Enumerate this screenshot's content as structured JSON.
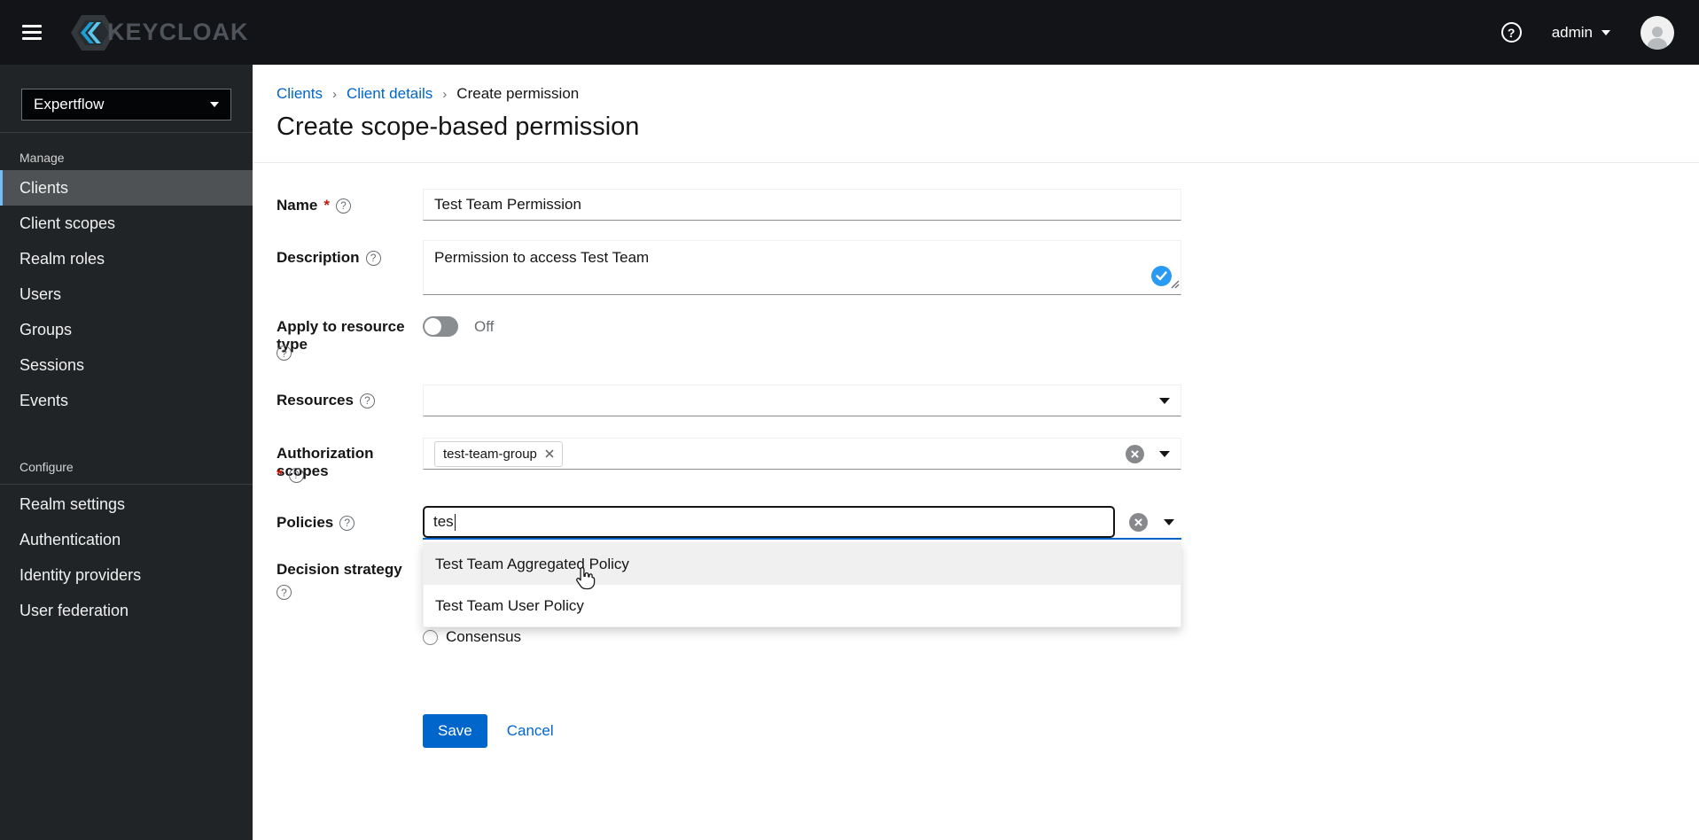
{
  "header": {
    "brand_text": "KEYCLOAK",
    "username": "admin"
  },
  "sidebar": {
    "realm_selector": {
      "value": "Expertflow"
    },
    "sections": [
      {
        "label": "Manage",
        "items": [
          {
            "label": "Clients",
            "active": true
          },
          {
            "label": "Client scopes",
            "active": false
          },
          {
            "label": "Realm roles",
            "active": false
          },
          {
            "label": "Users",
            "active": false
          },
          {
            "label": "Groups",
            "active": false
          },
          {
            "label": "Sessions",
            "active": false
          },
          {
            "label": "Events",
            "active": false
          }
        ]
      },
      {
        "label": "Configure",
        "items": [
          {
            "label": "Realm settings",
            "active": false
          },
          {
            "label": "Authentication",
            "active": false
          },
          {
            "label": "Identity providers",
            "active": false
          },
          {
            "label": "User federation",
            "active": false
          }
        ]
      }
    ]
  },
  "breadcrumb": {
    "items": [
      "Clients",
      "Client details",
      "Create permission"
    ],
    "separator": "›"
  },
  "page_title": "Create scope-based permission",
  "icons": {
    "help_glyph": "?",
    "required_marker": "*"
  },
  "form": {
    "name": {
      "label": "Name",
      "value": "Test Team Permission"
    },
    "description": {
      "label": "Description",
      "value": "Permission to access Test Team"
    },
    "apply_to_resource_type": {
      "label": "Apply to resource type",
      "state_label": "Off"
    },
    "resources": {
      "label": "Resources",
      "value": ""
    },
    "authorization_scopes": {
      "label": "Authorization scopes",
      "chip": "test-team-group"
    },
    "policies": {
      "label": "Policies",
      "input_value": "tes"
    },
    "policies_dropdown": {
      "options": [
        "Test Team Aggregated Policy",
        "Test Team User Policy"
      ],
      "hovered_option": "Test Team Aggregated Policy"
    },
    "decision_strategy": {
      "label": "Decision strategy",
      "visible_option": "Consensus"
    },
    "save_label": "Save",
    "cancel_label": "Cancel"
  },
  "colors": {
    "accent_blue": "#0066cc",
    "nav_active_border": "#73bcf7",
    "badge_blue": "#2b9af3",
    "danger_red": "#c9190b",
    "header_bg": "#121417",
    "sidebar_bg": "#212427"
  }
}
